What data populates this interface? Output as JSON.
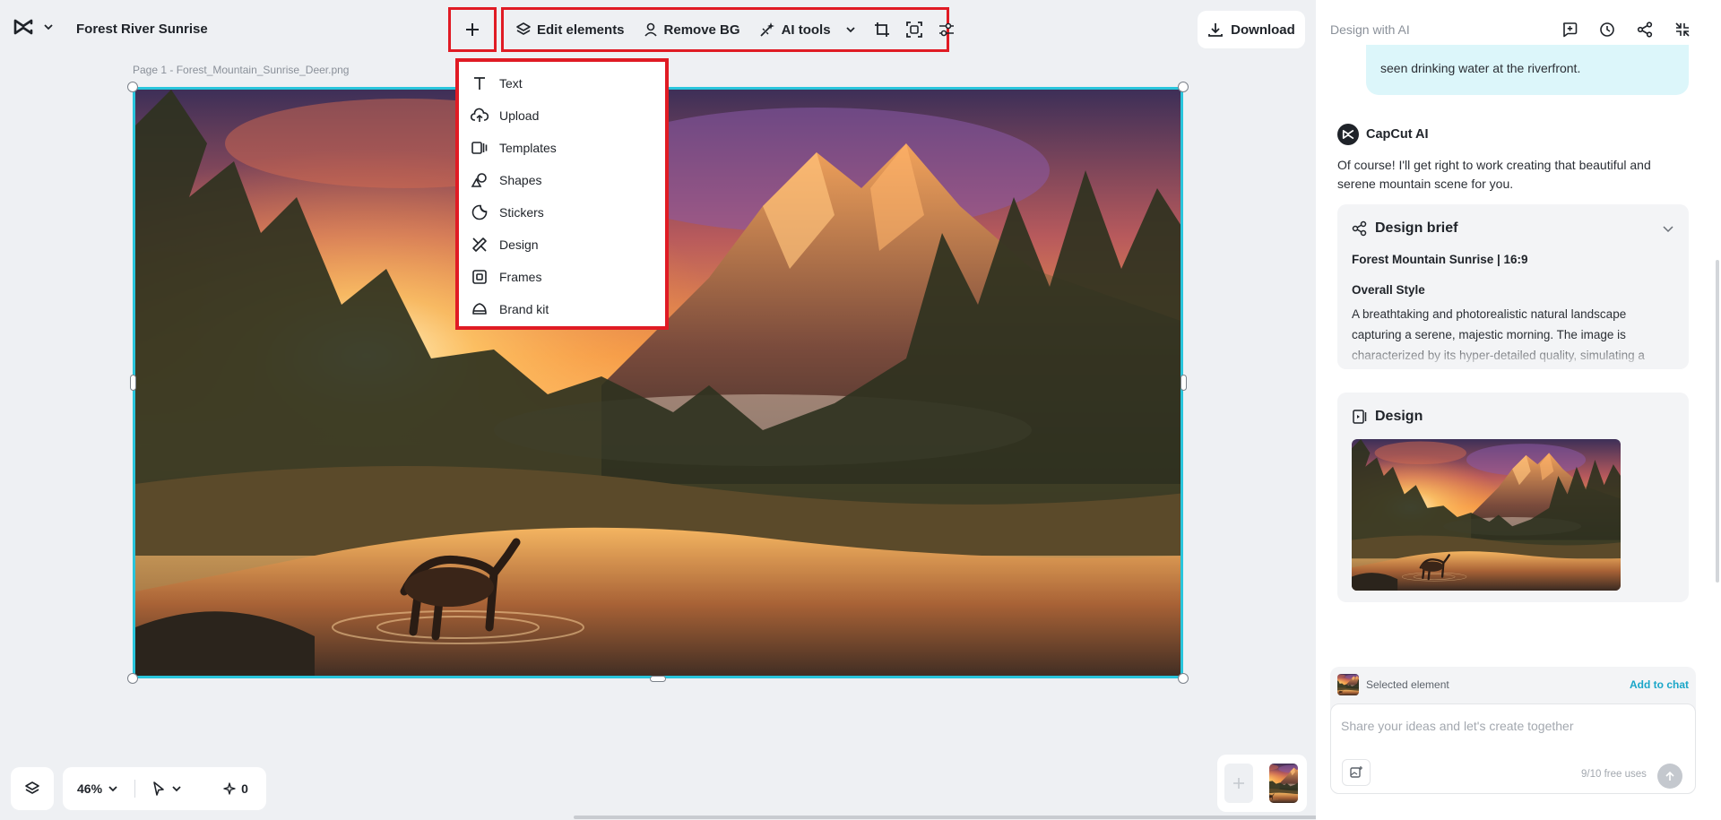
{
  "app": {
    "project_title": "Forest River Sunrise"
  },
  "toolbar": {
    "edit_elements": "Edit elements",
    "remove_bg": "Remove BG",
    "ai_tools": "AI tools",
    "download": "Download"
  },
  "canvas": {
    "page_label": "Page 1 -   Forest_Mountain_Sunrise_Deer.png"
  },
  "add_menu": {
    "items": [
      {
        "label": "Text",
        "icon": "text-icon"
      },
      {
        "label": "Upload",
        "icon": "upload-cloud-icon"
      },
      {
        "label": "Templates",
        "icon": "templates-icon"
      },
      {
        "label": "Shapes",
        "icon": "shapes-icon"
      },
      {
        "label": "Stickers",
        "icon": "stickers-icon"
      },
      {
        "label": "Design",
        "icon": "design-icon"
      },
      {
        "label": "Frames",
        "icon": "frames-icon"
      },
      {
        "label": "Brand kit",
        "icon": "brand-kit-icon"
      }
    ]
  },
  "bottom_bar": {
    "zoom": "46%",
    "magic_count": "0"
  },
  "panel": {
    "header": "Design with AI",
    "user_message_tail": "seen drinking water at the riverfront.",
    "ai_name": "CapCut AI",
    "ai_message": "Of course! I'll get right to work creating that beautiful and serene mountain scene for you.",
    "brief": {
      "title": "Design brief",
      "subtitle": "Forest Mountain Sunrise | 16:9",
      "heading": "Overall Style",
      "text": "A breathtaking and photorealistic natural landscape capturing a serene, majestic morning. The image is characterized by its hyper-detailed quality, simulating a"
    },
    "design": {
      "title": "Design"
    },
    "selected_element": "Selected element",
    "add_to_chat": "Add to chat",
    "input_placeholder": "Share your ideas and let's create together",
    "free_uses": "9/10 free uses"
  },
  "colors": {
    "accent": "#29c5dc",
    "highlight": "#e01b24",
    "link": "#1aa6c8"
  }
}
